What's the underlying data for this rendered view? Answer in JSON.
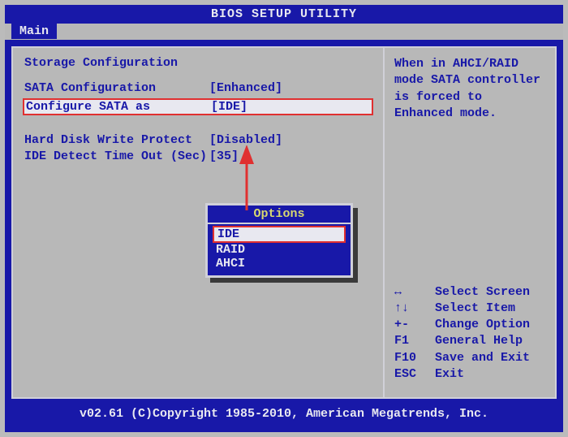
{
  "title": "BIOS SETUP UTILITY",
  "tab": "Main",
  "section_title": "Storage Configuration",
  "settings": {
    "sata_config": {
      "label": "SATA Configuration",
      "value": "[Enhanced]"
    },
    "configure_sata_as": {
      "label": "Configure SATA as",
      "value": "[IDE]"
    },
    "hd_write_protect": {
      "label": "Hard Disk Write Protect",
      "value": "[Disabled]"
    },
    "ide_timeout": {
      "label": "IDE Detect Time Out (Sec)",
      "value": "[35]"
    }
  },
  "popup": {
    "title": "Options",
    "options": [
      "IDE",
      "RAID",
      "AHCI"
    ]
  },
  "help_text": "When in AHCI/RAID mode SATA controller is forced to Enhanced mode.",
  "nav": [
    {
      "key": "↔",
      "label": "Select Screen"
    },
    {
      "key": "↑↓",
      "label": "Select Item"
    },
    {
      "key": "+-",
      "label": "Change Option"
    },
    {
      "key": "F1",
      "label": "General Help"
    },
    {
      "key": "F10",
      "label": "Save and Exit"
    },
    {
      "key": "ESC",
      "label": "Exit"
    }
  ],
  "footer": "v02.61 (C)Copyright 1985-2010, American Megatrends, Inc."
}
